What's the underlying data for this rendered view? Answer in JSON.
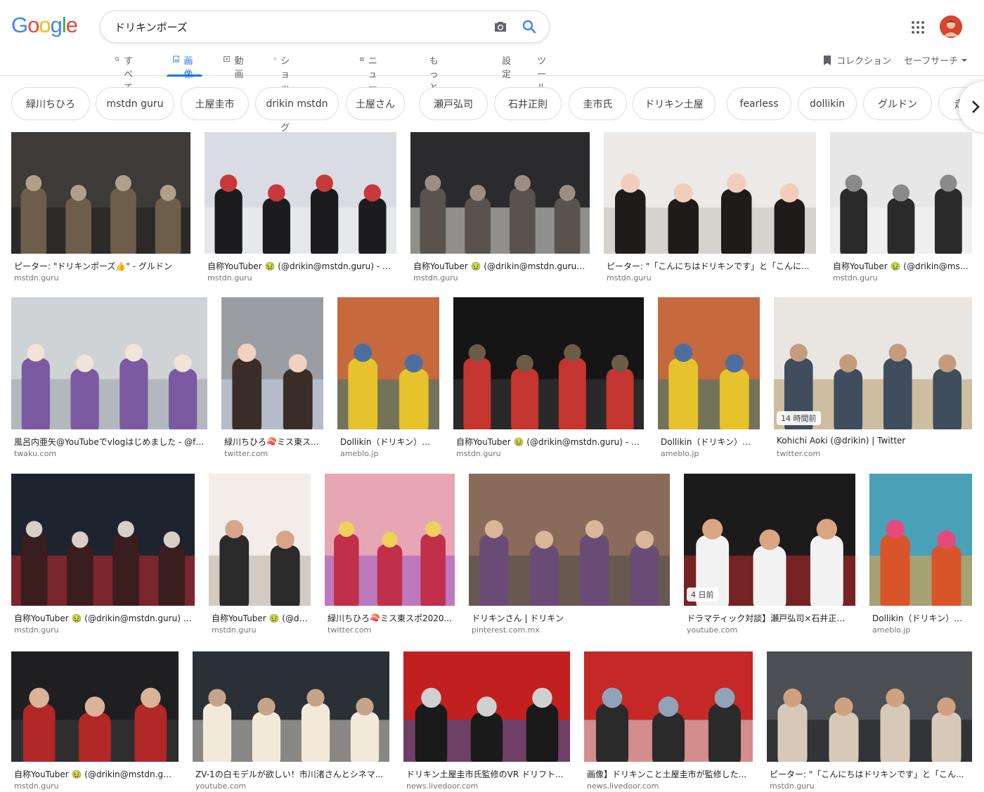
{
  "logo": {
    "letters": [
      "G",
      "o",
      "o",
      "g",
      "l",
      "e"
    ],
    "colors": [
      "#4285f4",
      "#ea4335",
      "#fbbc05",
      "#4285f4",
      "#34a853",
      "#ea4335"
    ]
  },
  "search": {
    "query": "ドリキンポーズ"
  },
  "tabs": [
    {
      "label": "すべて",
      "icon": "search-icon"
    },
    {
      "label": "画像",
      "icon": "image-icon",
      "active": true
    },
    {
      "label": "動画",
      "icon": "play-icon"
    },
    {
      "label": "ショッピング",
      "icon": "tag-icon"
    },
    {
      "label": "ニュース",
      "icon": "news-icon"
    },
    {
      "label": "もっと見る",
      "icon": "more-vert-icon"
    },
    {
      "label": "設定"
    },
    {
      "label": "ツール"
    }
  ],
  "right_tools": {
    "collection": "コレクション",
    "safe_search": "セーフサーチ"
  },
  "chips": [
    "緑川ちひろ",
    "mstdn guru",
    "土屋圭市",
    "drikin mstdn",
    "土屋さん",
    "瀬戸弘司",
    "石井正則",
    "圭市氏",
    "ドリキン土屋",
    "fearless",
    "dollikin",
    "グルドン",
    "走"
  ],
  "results": [
    {
      "title": "ピーター: \"ドリキンポーズ👍\" - グルドン",
      "source": "mstdn.guru"
    },
    {
      "title": "自称YouTuber 🤢 (@drikin@mstdn.guru) - グ...",
      "source": "mstdn.guru"
    },
    {
      "title": "自称YouTuber 🤢 (@drikin@mstdn.guru) - ...",
      "source": "mstdn.guru"
    },
    {
      "title": "ピーター: \"「こんにちはドリキンです」と「こんに...",
      "source": "mstdn.guru"
    },
    {
      "title": "自称YouTuber 🤢 (@drikin@mstd...",
      "source": "mstdn.guru"
    },
    {
      "title": "風呂内亜矢@YouTubeでvlogはじめました - @fu...",
      "source": "twaku.com"
    },
    {
      "title": "緑川ちひろ🍣ミス東ス...",
      "source": "twitter.com"
    },
    {
      "title": "Dollikin（ドリキン）ち...",
      "source": "ameblo.jp"
    },
    {
      "title": "自称YouTuber 🤢 (@drikin@mstdn.guru) - グ...",
      "source": "mstdn.guru"
    },
    {
      "title": "Dollikin（ドリキン）ち...",
      "source": "ameblo.jp"
    },
    {
      "title": "Kohichi Aoki (@drikin) | Twitter",
      "source": "twitter.com",
      "badge": "14 時間前"
    },
    {
      "title": "自称YouTuber 🤢 (@drikin@mstdn.guru) - ...",
      "source": "mstdn.guru"
    },
    {
      "title": "自称YouTuber 🤢 (@dr...",
      "source": "mstdn.guru"
    },
    {
      "title": "緑川ちひろ🍣ミス東スポ2020...",
      "source": "twitter.com"
    },
    {
      "title": "ドリキンさん | ドリキン",
      "source": "pinterest.com.mx"
    },
    {
      "title": "ドラマティック対談】瀬戸弘司×石井正則...",
      "source": "youtube.com",
      "badge": "4 日前"
    },
    {
      "title": "Dollikin（ドリキン）ち...",
      "source": "ameblo.jp"
    },
    {
      "title": "自称YouTuber 🤢 (@drikin@mstdn.guru...",
      "source": "mstdn.guru"
    },
    {
      "title": "ZV-1の白モデルが欲しい！市川渚さんとシネマ...",
      "source": "youtube.com"
    },
    {
      "title": "ドリキン土屋圭市氏監修のVR ドリフト...",
      "source": "news.livedoor.com"
    },
    {
      "title": "画像】ドリキンこと土屋圭市が監修した...",
      "source": "news.livedoor.com"
    },
    {
      "title": "ピーター: \"「こんにちはドリキンです」と「こん...",
      "source": "mstdn.guru"
    }
  ]
}
